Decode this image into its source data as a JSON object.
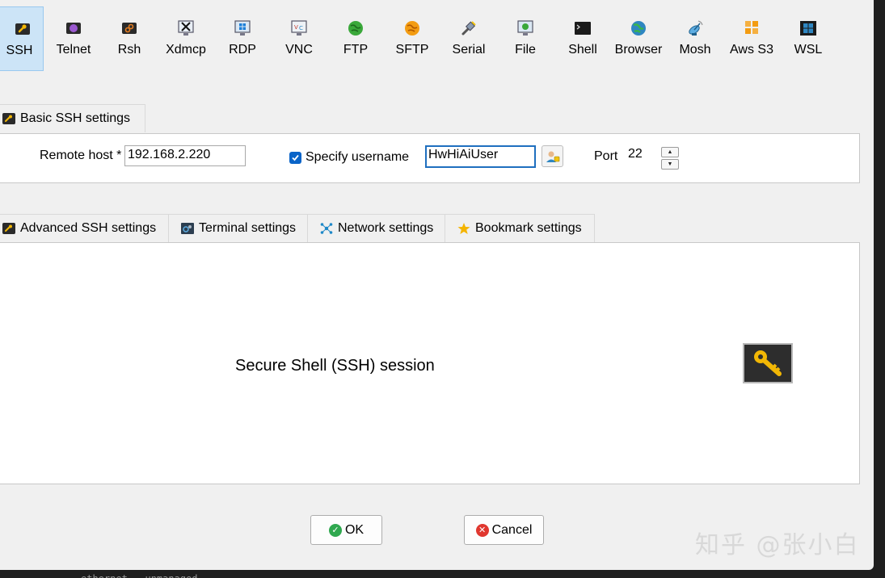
{
  "toolbar": {
    "items": [
      {
        "label": "SSH",
        "icon": "wrench-icon",
        "active": true
      },
      {
        "label": "Telnet",
        "icon": "telnet-icon"
      },
      {
        "label": "Rsh",
        "icon": "rsh-icon"
      },
      {
        "label": "Xdmcp",
        "icon": "x-display-icon"
      },
      {
        "label": "RDP",
        "icon": "windows-monitor-icon"
      },
      {
        "label": "VNC",
        "icon": "vnc-monitor-icon"
      },
      {
        "label": "FTP",
        "icon": "globe-green-icon"
      },
      {
        "label": "SFTP",
        "icon": "globe-orange-icon"
      },
      {
        "label": "Serial",
        "icon": "serial-plug-icon"
      },
      {
        "label": "File",
        "icon": "file-monitor-icon"
      },
      {
        "label": "Shell",
        "icon": "terminal-icon"
      },
      {
        "label": "Browser",
        "icon": "browser-globe-icon"
      },
      {
        "label": "Mosh",
        "icon": "satellite-icon"
      },
      {
        "label": "Aws S3",
        "icon": "aws-cubes-icon"
      },
      {
        "label": "WSL",
        "icon": "windows-logo-icon"
      }
    ]
  },
  "basic": {
    "tab_label": "Basic SSH settings",
    "remote_host_label": "Remote host *",
    "remote_host_value": "192.168.2.220",
    "specify_username_label": "Specify username",
    "username_value": "HwHiAiUser",
    "port_label": "Port",
    "port_value": "22"
  },
  "advanced_tabs": [
    {
      "label": "Advanced SSH settings",
      "icon": "wrench-icon"
    },
    {
      "label": "Terminal settings",
      "icon": "terminal-settings-icon"
    },
    {
      "label": "Network settings",
      "icon": "network-icon"
    },
    {
      "label": "Bookmark settings",
      "icon": "star-icon"
    }
  ],
  "main": {
    "description": "Secure Shell (SSH) session"
  },
  "buttons": {
    "ok": "OK",
    "cancel": "Cancel"
  },
  "watermark": "知乎 @张小白",
  "terminal_peek": "ethernet   unmanaged",
  "colors": {
    "active_tab_bg": "#cce4f7",
    "checkbox": "#0a64c8",
    "ok_green": "#2fa84f",
    "cancel_red": "#e0372f",
    "key_gold": "#f2b705"
  }
}
